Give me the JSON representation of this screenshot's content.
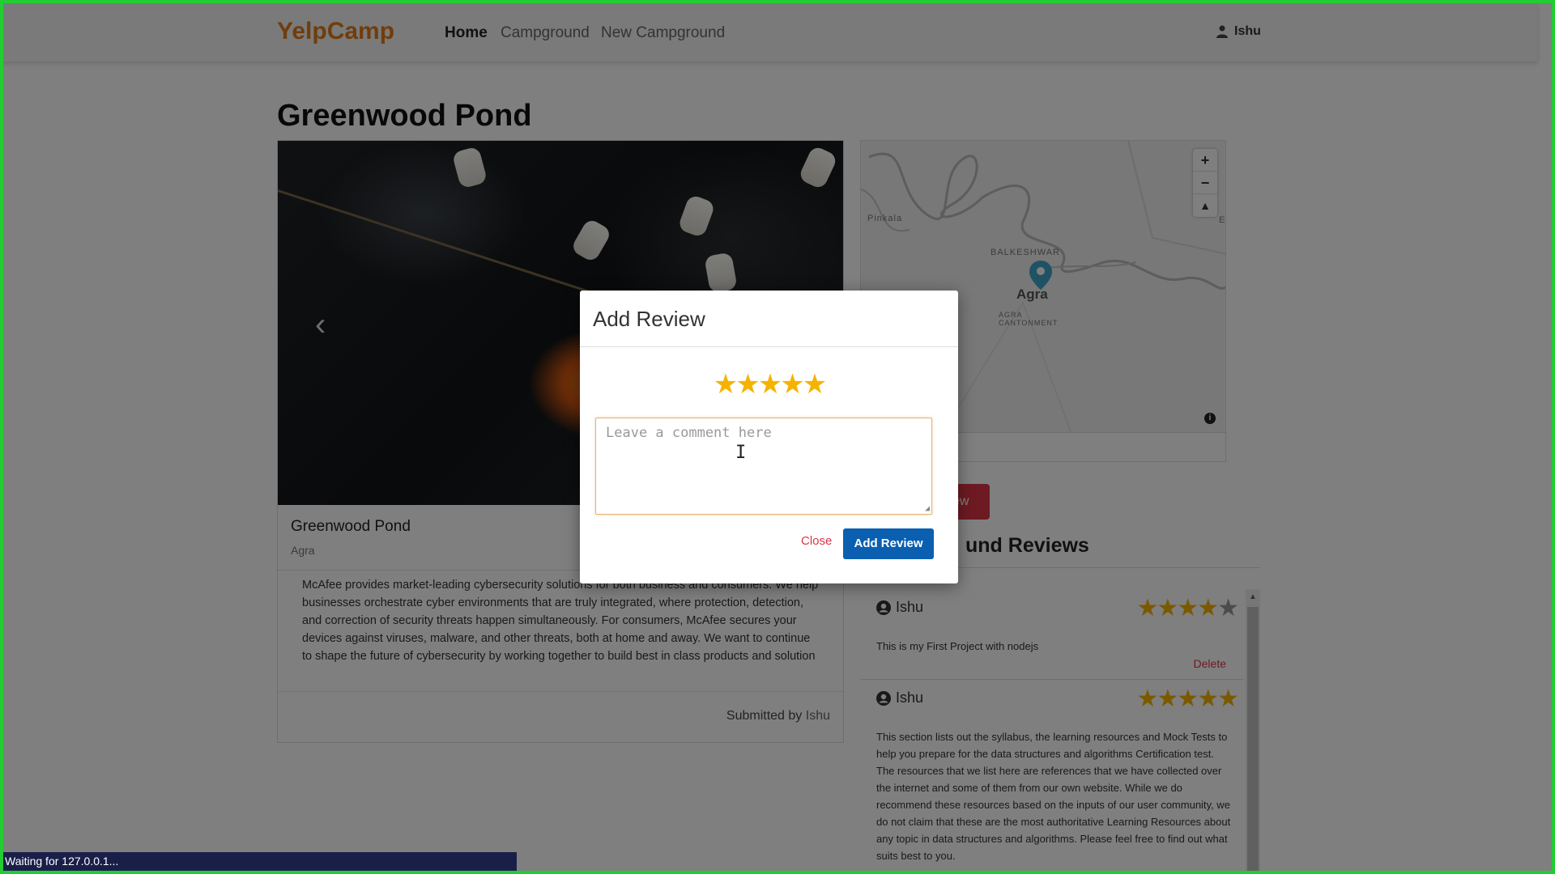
{
  "navbar": {
    "brand": "YelpCamp",
    "links": [
      {
        "label": "Home"
      },
      {
        "label": "Campground"
      },
      {
        "label": "New Campground"
      }
    ],
    "user": "Ishu"
  },
  "campground": {
    "title": "Greenwood Pond",
    "card_title": "Greenwood Pond",
    "location": "Agra",
    "description": "McAfee provides market-leading cybersecurity solutions for both business and consumers. We help businesses orchestrate cyber environments that are truly integrated, where protection, detection, and correction of security threats happen simultaneously. For consumers, McAfee secures your devices against viruses, malware, and other threats, both at home and away. We want to continue to shape the future of cybersecurity by working together to build best in class products and solution",
    "submitted_prefix": "Submitted by",
    "submitted_by": "Ishu",
    "carousel_prev_glyph": "‹"
  },
  "map": {
    "labels": [
      "Pinkala",
      "BALKESHWAR",
      "AGRA CANTONMENT"
    ],
    "city": "Agra",
    "zoom_in": "+",
    "zoom_out": "−",
    "compass": "▲",
    "info": "i",
    "edge_label": "Et"
  },
  "side_button_label": "ew",
  "reviews": {
    "title": "und Reviews",
    "items": [
      {
        "author": "Ishu",
        "rating": 4,
        "body": "This is my First Project with nodejs",
        "delete_label": "Delete"
      },
      {
        "author": "Ishu",
        "rating": 5,
        "body": "This section lists out the syllabus, the learning resources and Mock Tests to help you prepare for the data structures and algorithms Certification test. The resources that we list here are references that we have collected over the internet and some of them from our own website. While we do recommend these resources based on the inputs of our user community, we do not claim that these are the most authoritative Learning Resources about any topic in data structures and algorithms. Please feel free to find out what suits best to you."
      }
    ]
  },
  "modal": {
    "title": "Add Review",
    "rating": 5,
    "star_glyphs": "★★★★★",
    "comment_placeholder": "Leave a comment here",
    "comment_value": "",
    "close_label": "Close",
    "submit_label": "Add Review"
  },
  "statusbar": {
    "text": "Waiting for 127.0.0.1..."
  },
  "colors": {
    "brand": "#e07b1a",
    "primary": "#0b5fb0",
    "danger": "#dc3545",
    "star": "#f5b301",
    "frame": "#22cc33"
  }
}
